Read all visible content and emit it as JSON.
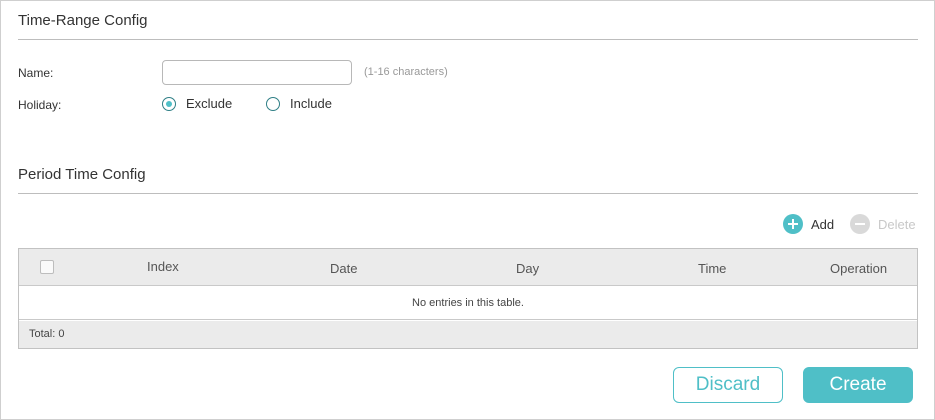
{
  "colors": {
    "accent": "#4fbfc7",
    "disabled": "#d9d9d9",
    "rule": "#bdbdbd",
    "table_header_bg": "#ebebeb"
  },
  "time_range_config": {
    "title": "Time-Range Config",
    "name_label": "Name:",
    "name_value": "",
    "name_hint": "(1-16 characters)",
    "holiday_label": "Holiday:",
    "holiday_options": [
      {
        "label": "Exclude",
        "selected": true
      },
      {
        "label": "Include",
        "selected": false
      }
    ]
  },
  "period_time_config": {
    "title": "Period Time Config",
    "add_label": "Add",
    "add_icon": "plus-circle-icon",
    "delete_label": "Delete",
    "delete_icon": "minus-circle-icon",
    "table": {
      "columns": [
        "Index",
        "Date",
        "Day",
        "Time",
        "Operation"
      ],
      "empty_text": "No entries in this table.",
      "total_text": "Total: 0"
    }
  },
  "buttons": {
    "discard": "Discard",
    "create": "Create"
  }
}
